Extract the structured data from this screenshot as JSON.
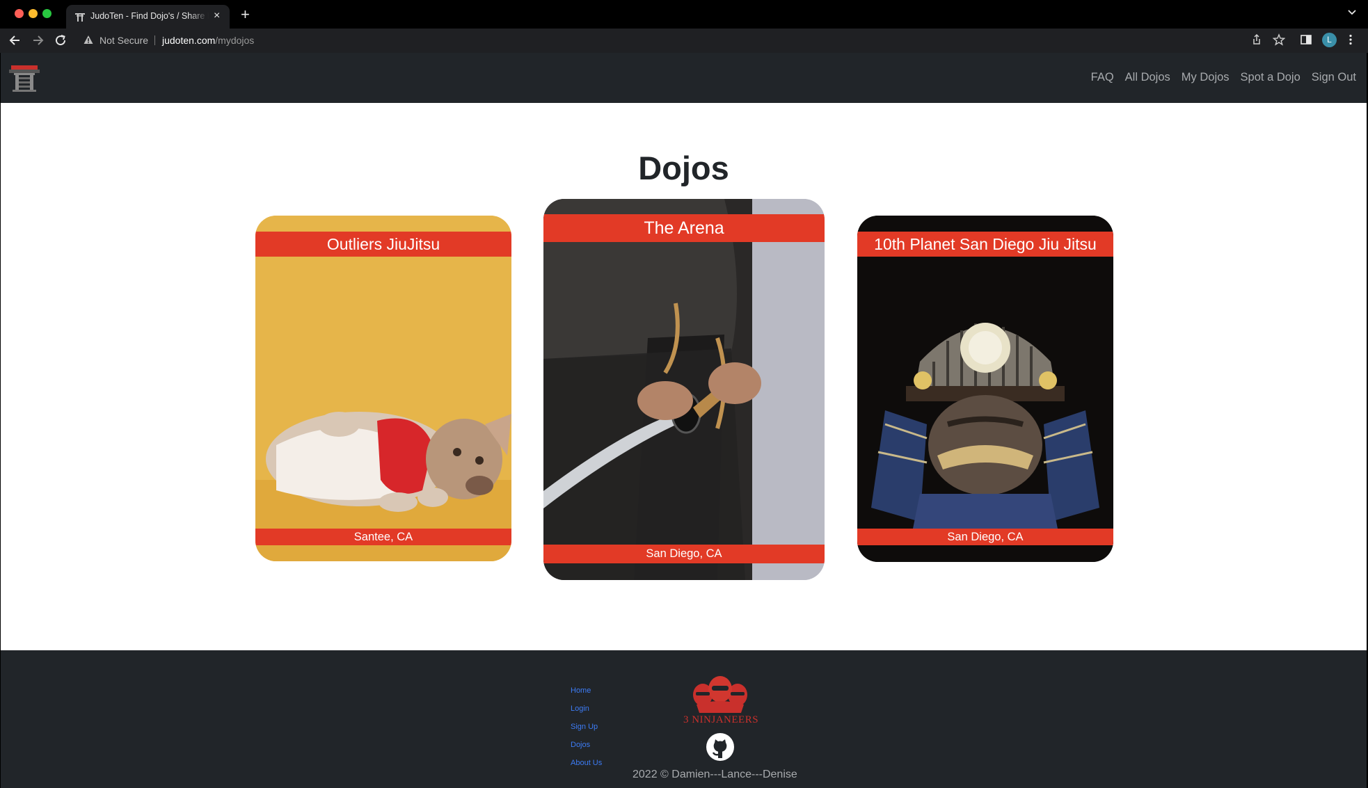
{
  "browser": {
    "tab_title": "JudoTen - Find Dojo's / Share Dojo's",
    "tab_close": "×",
    "new_tab": "+",
    "security_label": "Not Secure",
    "url_domain": "judoten.com",
    "url_path": "/mydojos",
    "profile_initial": "L"
  },
  "nav": {
    "links": [
      "FAQ",
      "All Dojos",
      "My Dojos",
      "Spot a Dojo",
      "Sign Out"
    ]
  },
  "page": {
    "title": "Dojos"
  },
  "dojos": [
    {
      "name": "Outliers JiuJitsu",
      "location": "Santee, CA"
    },
    {
      "name": "The Arena",
      "location": "San Diego, CA"
    },
    {
      "name": "10th Planet San Diego Jiu Jitsu",
      "location": "San Diego, CA"
    }
  ],
  "footer": {
    "links": [
      "Home",
      "Login",
      "Sign Up",
      "Dojos",
      "About Us"
    ],
    "brand": "3 NINJANEERS",
    "copyright": "2022 © Damien---Lance---Denise"
  },
  "colors": {
    "accent_red": "#e23a26",
    "navbar": "#212529",
    "footer_link": "#3d7cf5"
  }
}
